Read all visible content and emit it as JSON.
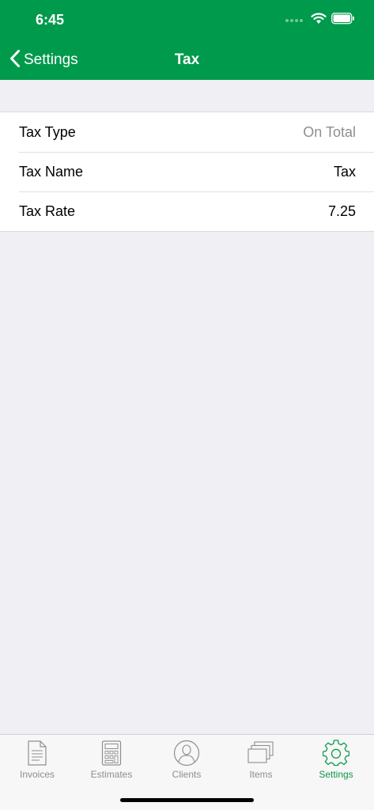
{
  "status_bar": {
    "time": "6:45"
  },
  "nav": {
    "back_label": "Settings",
    "title": "Tax"
  },
  "rows": [
    {
      "label": "Tax Type",
      "value": "On Total"
    },
    {
      "label": "Tax Name",
      "value": "Tax"
    },
    {
      "label": "Tax Rate",
      "value": "7.25"
    }
  ],
  "tabs": [
    {
      "label": "Invoices",
      "icon": "document-icon"
    },
    {
      "label": "Estimates",
      "icon": "calculator-icon"
    },
    {
      "label": "Clients",
      "icon": "person-icon"
    },
    {
      "label": "Items",
      "icon": "stack-icon"
    },
    {
      "label": "Settings",
      "icon": "gear-icon",
      "active": true
    }
  ],
  "colors": {
    "header": "#009a4c",
    "accent": "#0a9a48",
    "background": "#efeff4",
    "muted": "#8e8e93"
  }
}
